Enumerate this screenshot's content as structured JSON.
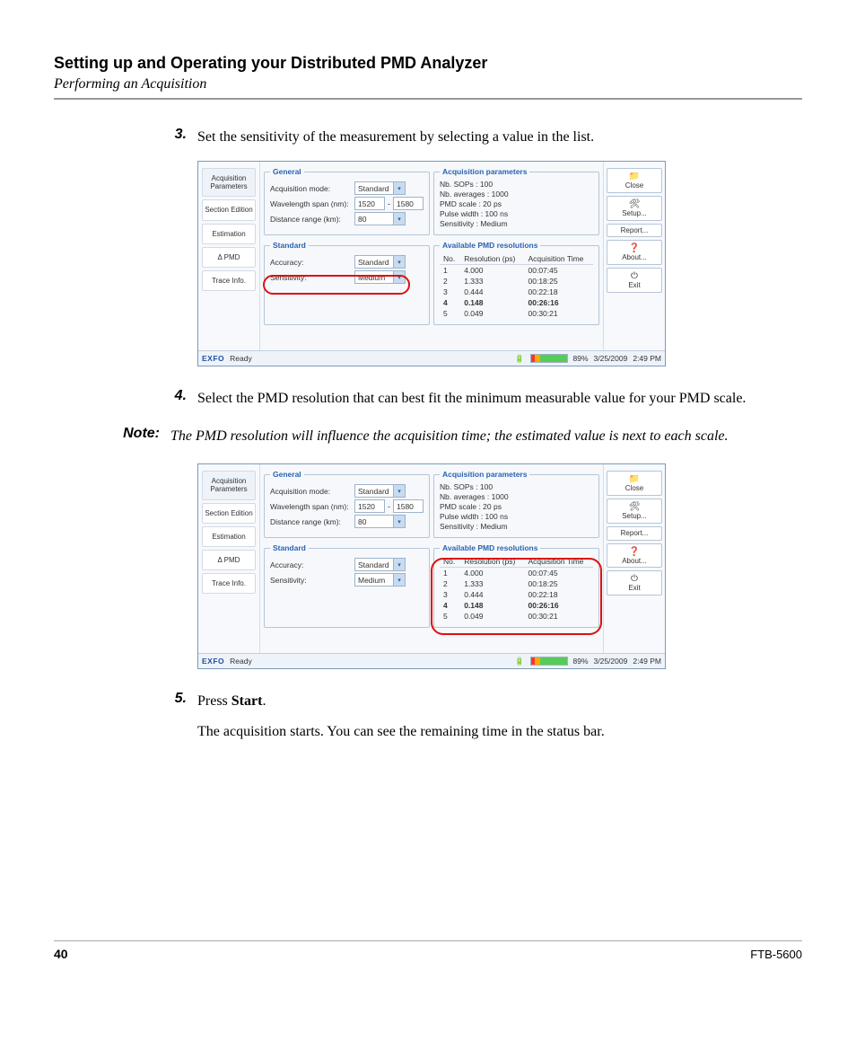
{
  "heading": "Setting up and Operating your Distributed PMD Analyzer",
  "subheading": "Performing an Acquisition",
  "steps": {
    "s3": {
      "num": "3.",
      "text": "Set the sensitivity of the measurement by selecting a value in the list."
    },
    "s4": {
      "num": "4.",
      "text": "Select the PMD resolution that can best fit the minimum measurable value for your PMD scale."
    },
    "s5": {
      "num": "5.",
      "text_prefix": "Press ",
      "text_bold": "Start",
      "text_suffix": ".",
      "after": "The acquisition starts. You can see the remaining time in the status bar."
    }
  },
  "note": {
    "label": "Note:",
    "text": "The PMD resolution will influence the acquisition time; the estimated value is next to each scale."
  },
  "footer": {
    "page": "40",
    "model": "FTB-5600"
  },
  "app": {
    "nav": [
      "Acquisition\nParameters",
      "Section Edition",
      "Estimation",
      "Δ PMD",
      "Trace Info."
    ],
    "general": {
      "legend": "General",
      "mode_label": "Acquisition mode:",
      "mode_value": "Standard",
      "wl_label": "Wavelength span (nm):",
      "wl_from": "1520",
      "wl_to": "1580",
      "dist_label": "Distance range (km):",
      "dist_value": "80"
    },
    "standard": {
      "legend": "Standard",
      "accuracy_label": "Accuracy:",
      "accuracy_value": "Standard",
      "sensitivity_label": "Sensitivity:",
      "sensitivity_value": "Medium"
    },
    "acq_params": {
      "legend": "Acquisition parameters",
      "lines": [
        "Nb. SOPs : 100",
        "Nb. averages : 1000",
        "PMD scale : 20 ps",
        "Pulse width : 100 ns",
        "Sensitivity : Medium"
      ]
    },
    "resolutions": {
      "legend": "Available PMD resolutions",
      "headers": [
        "No.",
        "Resolution (ps)",
        "Acquisition Time"
      ],
      "rows": [
        {
          "no": "1",
          "res": "4.000",
          "time": "00:07:45",
          "hl": false
        },
        {
          "no": "2",
          "res": "1.333",
          "time": "00:18:25",
          "hl": false
        },
        {
          "no": "3",
          "res": "0.444",
          "time": "00:22:18",
          "hl": false
        },
        {
          "no": "4",
          "res": "0.148",
          "time": "00:26:16",
          "hl": true
        },
        {
          "no": "5",
          "res": "0.049",
          "time": "00:30:21",
          "hl": false
        }
      ]
    },
    "buttons": {
      "close": "Close",
      "setup": "Setup...",
      "report": "Report...",
      "about": "About...",
      "exit": "Exit"
    },
    "status": {
      "brand": "EXFO",
      "state": "Ready",
      "battery": "89%",
      "date": "3/25/2009",
      "time": "2:49 PM"
    }
  }
}
